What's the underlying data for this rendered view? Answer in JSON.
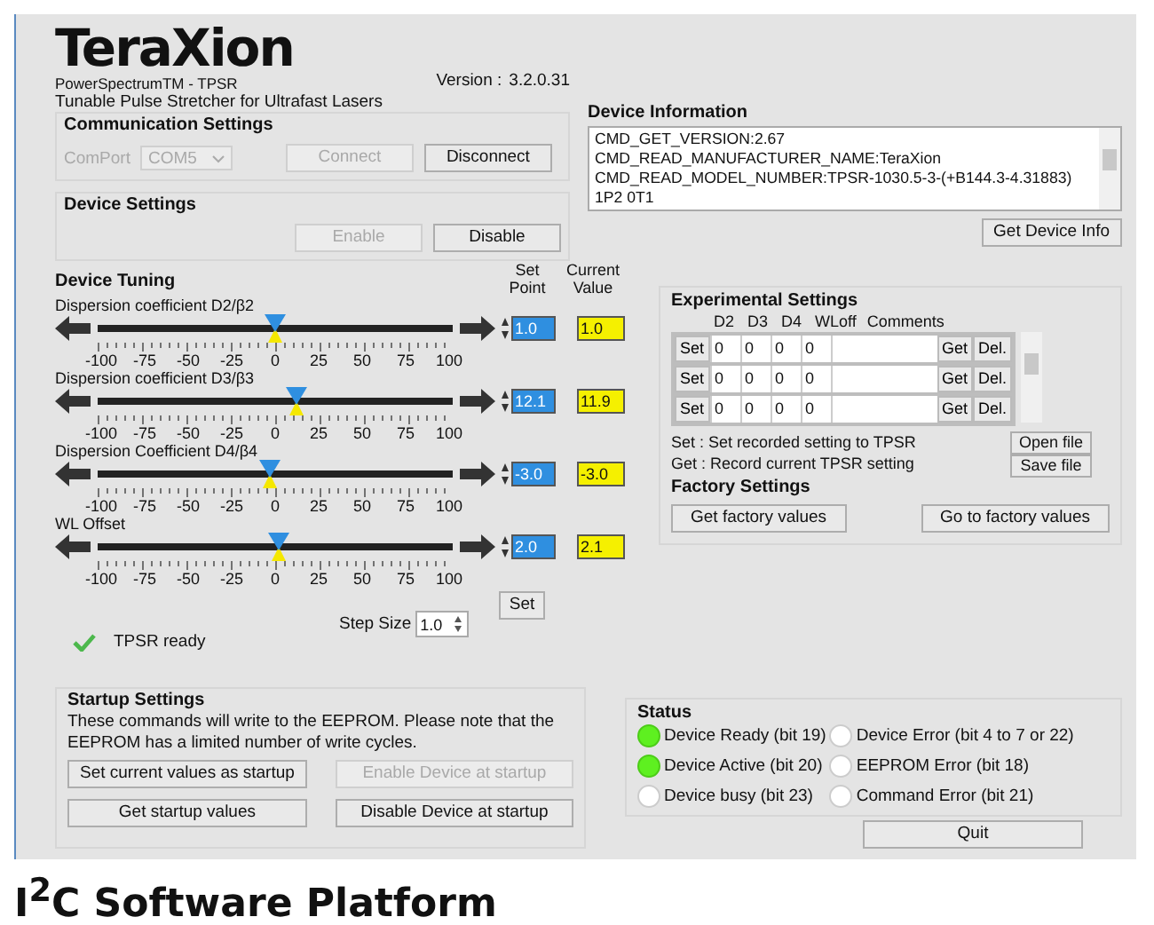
{
  "logo": "TeraXion",
  "product": "PowerSpectrumTM - TPSR",
  "tagline": "Tunable Pulse Stretcher for Ultrafast Lasers",
  "version_label": "Version :",
  "version": "3.2.0.31",
  "communication": {
    "title": "Communication Settings",
    "port_label": "ComPort",
    "port": "COM5",
    "port_disabled": true,
    "buttons": [
      {
        "label": "Connect",
        "disabled": true
      },
      {
        "label": "Disconnect",
        "disabled": false
      }
    ]
  },
  "device_settings": {
    "title": "Device Settings",
    "buttons": [
      {
        "label": "Enable",
        "disabled": true
      },
      {
        "label": "Disable",
        "disabled": false
      }
    ]
  },
  "device_info": {
    "title": "Device Information",
    "lines": [
      "CMD_GET_VERSION:2.67",
      "CMD_READ_MANUFACTURER_NAME:TeraXion",
      "CMD_READ_MODEL_NUMBER:TPSR-1030.5-3-(+B144.3-4.31883) 1P2 0T1"
    ],
    "button": "Get Device Info"
  },
  "tuning": {
    "title": "Device Tuning",
    "set_point_header": "Set Point",
    "current_header": "Current Value",
    "sliders": [
      {
        "label": "Dispersion coefficient D2/β2",
        "level": 0.5,
        "ticks": [
          "-100",
          "-75",
          "-50",
          "-25",
          "0",
          "25",
          "50",
          "75",
          "100"
        ],
        "set_point": "1.0",
        "current": "1.0"
      },
      {
        "label": "Dispersion coefficient D3/β3",
        "level": 0.56,
        "ticks": [
          "-100",
          "-75",
          "-50",
          "-25",
          "0",
          "25",
          "50",
          "75",
          "100"
        ],
        "set_point": "12.1",
        "current": "11.9"
      },
      {
        "label": "Dispersion Coefficient D4/β4",
        "level": 0.485,
        "ticks": [
          "-100",
          "-75",
          "-50",
          "-25",
          "0",
          "25",
          "50",
          "75",
          "100"
        ],
        "set_point": "-3.0",
        "current": "-3.0"
      },
      {
        "label": "WL Offset",
        "level": 0.51,
        "ticks": [
          "-100",
          "-75",
          "-50",
          "-25",
          "0",
          "25",
          "50",
          "75",
          "100"
        ],
        "set_point": "2.0",
        "current": "2.1"
      }
    ],
    "set_button": "Set",
    "step_label": "Step Size",
    "step": "1.0",
    "ready": {
      "text": "TPSR ready",
      "ok": true
    }
  },
  "experimental": {
    "title": "Experimental Settings",
    "columns": [
      "D2",
      "D3",
      "D4",
      "WLoff",
      "Comments"
    ],
    "rows": [
      {
        "set": "Set",
        "values": [
          "0",
          "0",
          "0",
          "0"
        ],
        "get": "Get",
        "del": "Del."
      },
      {
        "set": "Set",
        "values": [
          "0",
          "0",
          "0",
          "0"
        ],
        "get": "Get",
        "del": "Del."
      },
      {
        "set": "Set",
        "values": [
          "0",
          "0",
          "0",
          "0"
        ],
        "get": "Get",
        "del": "Del."
      }
    ],
    "notes": [
      "Set : Set recorded setting to TPSR",
      "Get : Record current TPSR setting"
    ],
    "file_buttons": [
      "Open file",
      "Save file"
    ]
  },
  "factory": {
    "title": "Factory Settings",
    "buttons": [
      "Get factory values",
      "Go to factory values"
    ]
  },
  "startup": {
    "title": "Startup Settings",
    "note": "These commands will write to the EEPROM. Please note that the EEPROM has a limited number of write cycles.",
    "buttons": [
      {
        "label": "Set current values as startup",
        "disabled": false
      },
      {
        "label": "Enable Device at startup",
        "disabled": true
      },
      {
        "label": "Get startup values",
        "disabled": false
      },
      {
        "label": "Disable Device at startup",
        "disabled": false
      }
    ]
  },
  "status": {
    "title": "Status",
    "indicators": [
      {
        "label": "Device Ready (bit 19)",
        "on": true
      },
      {
        "label": "Device Error (bit 4 to 7 or 22)",
        "on": false
      },
      {
        "label": "Device Active (bit 20)",
        "on": true
      },
      {
        "label": "EEPROM Error (bit 18)",
        "on": false
      },
      {
        "label": "Device busy (bit 23)",
        "on": false
      },
      {
        "label": "Command Error (bit 21)",
        "on": false
      }
    ],
    "quit": "Quit"
  },
  "caption": "I$^{2}$C Software Platform"
}
